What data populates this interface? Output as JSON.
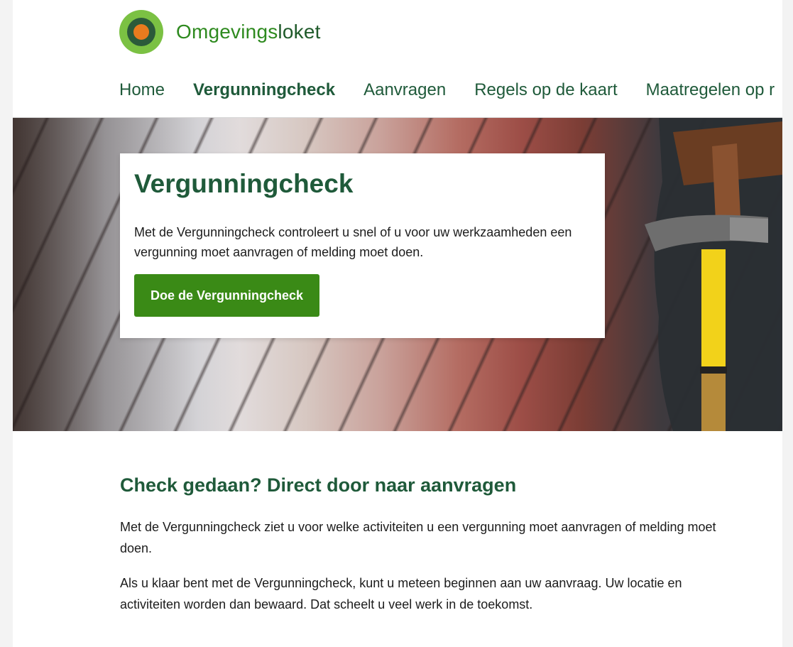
{
  "logo": {
    "name_bold": "Omgevings",
    "name_light": "loket",
    "colors": {
      "outer": "#7bc143",
      "mid": "#2b5a3a",
      "inner": "#e87b1e"
    }
  },
  "nav": {
    "items": [
      {
        "label": "Home",
        "active": false
      },
      {
        "label": "Vergunningcheck",
        "active": true
      },
      {
        "label": "Aanvragen",
        "active": false
      },
      {
        "label": "Regels op de kaart",
        "active": false
      },
      {
        "label": "Maatregelen op r",
        "active": false
      }
    ],
    "active_underline_color": "#86537a"
  },
  "hero": {
    "title": "Vergunningcheck",
    "text": "Met de Vergunningcheck controleert u snel of u voor uw werkzaamheden een vergunning moet aanvragen of melding moet doen.",
    "button_label": "Doe de Vergunningcheck",
    "button_color": "#3a8a16"
  },
  "content": {
    "title": "Check gedaan? Direct door naar aanvragen",
    "paragraphs": [
      "Met de Vergunningcheck ziet u voor welke activiteiten u een vergunning moet aanvragen of melding moet doen.",
      "Als u klaar bent met de Vergunningcheck, kunt u meteen beginnen aan uw aanvraag. Uw locatie en activiteiten worden dan bewaard. Dat scheelt u veel werk in de toekomst."
    ]
  },
  "colors": {
    "heading_green": "#1f5a3a",
    "brand_green": "#2e8a1f"
  }
}
